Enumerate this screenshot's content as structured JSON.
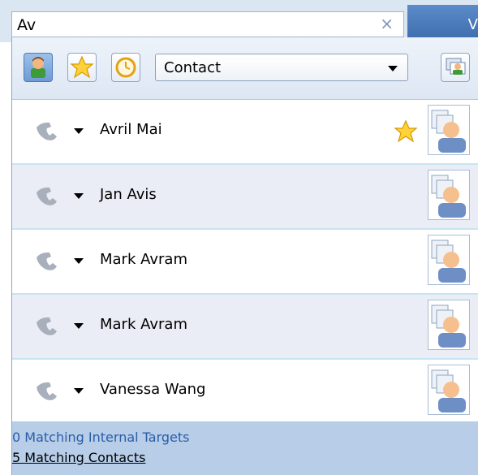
{
  "search": {
    "value": "Av",
    "clear_glyph": "×",
    "right_tab_glyph": "V"
  },
  "toolbar": {
    "buttons": [
      {
        "name": "contact-icon",
        "active": true
      },
      {
        "name": "favorites-star-icon",
        "active": false
      },
      {
        "name": "recent-clock-icon",
        "active": false
      }
    ],
    "select_value": "Contact",
    "add_contact_icon": "add-contact-icon"
  },
  "contacts": [
    {
      "name": "Avril Mai",
      "favorite": true
    },
    {
      "name": "Jan Avis",
      "favorite": false
    },
    {
      "name": "Mark Avram",
      "favorite": false
    },
    {
      "name": "Mark Avram",
      "favorite": false
    },
    {
      "name": "Vanessa Wang",
      "favorite": false
    }
  ],
  "footer": {
    "internal_targets": "0 Matching Internal Targets",
    "contacts": "5 Matching Contacts"
  },
  "colors": {
    "row_alt": "#ebedf6",
    "row_divider": "#c8e4f0",
    "footer_bg": "#b7cde8",
    "link_blue": "#2a5ea8"
  }
}
